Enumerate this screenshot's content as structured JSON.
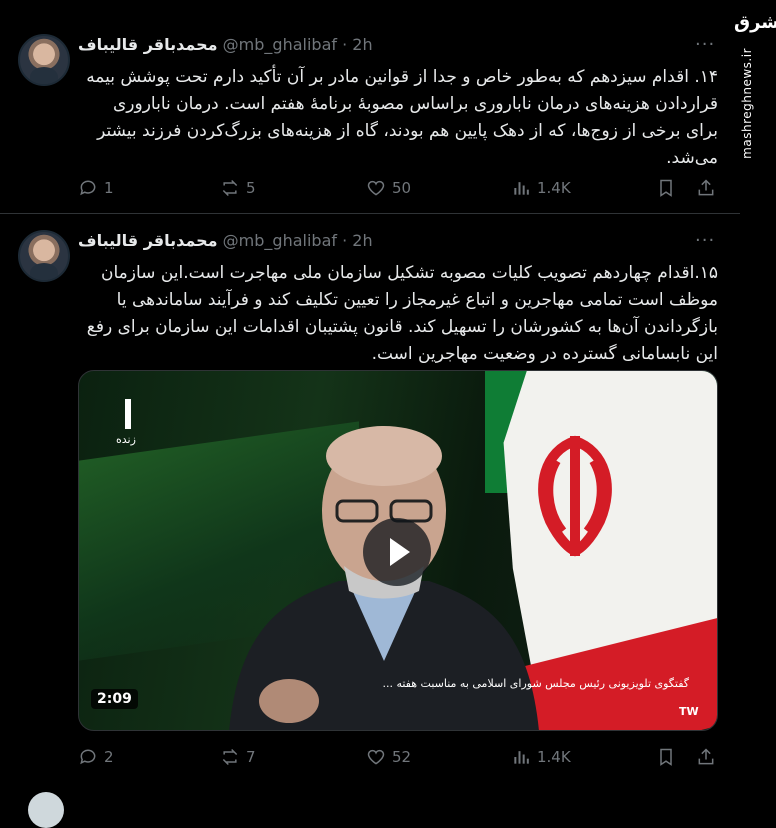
{
  "watermark": {
    "logo": "مشرق",
    "url": "mashreghnews.ir"
  },
  "tweets": [
    {
      "name": "محمدباقر قالیباف",
      "handle": "@mb_ghalibaf",
      "dot": "·",
      "time": "2h",
      "more": "···",
      "text": "۱۴. اقدام سیزدهم که به‌طور خاص و جدا از قوانین مادر بر آن تأکید دارم تحت پوشش بیمه قراردادن هزینه‌های درمان ناباروری براساس مصوبهٔ برنامهٔ هفتم است. درمان ناباروری برای برخی از زوج‌ها، که از دهک پایین هم بودند، گاه از هزینه‌های بزرگ‌کردن فرزند بیشتر می‌شد.",
      "stats": {
        "replies": "1",
        "reposts": "5",
        "likes": "50",
        "views": "1.4K"
      }
    },
    {
      "name": "محمدباقر قالیباف",
      "handle": "@mb_ghalibaf",
      "dot": "·",
      "time": "2h",
      "more": "···",
      "text": "۱۵.اقدام چهاردهم تصویب کلیات مصوبه تشکیل سازمان ملی مهاجرت است.این سازمان موظف است تمامی مهاجرین و اتباع غیرمجاز را تعیین تکلیف کند و فرآیند ساماندهی یا بازگرداندن آن‌ها به کشورشان را تسهیل کند. قانون پشتیبان اقدامات این سازمان برای رفع این نابسامانی گسترده در وضعیت مهاجرین است.",
      "video": {
        "live_label": "زنده",
        "caption": "گفتگوی تلویزیونی رئیس مجلس شورای اسلامی به مناسبت هفته ...",
        "duration": "2:09",
        "channel_badge": "TW"
      },
      "stats": {
        "replies": "2",
        "reposts": "7",
        "likes": "52",
        "views": "1.4K"
      }
    }
  ],
  "icons": [
    "reply-icon",
    "repost-icon",
    "like-icon",
    "views-icon",
    "bookmark-icon",
    "share-icon",
    "more-icon",
    "play-icon"
  ],
  "colors": {
    "background": "#000000",
    "text": "#e7e9ea",
    "muted": "#71767b",
    "border": "#2f3336"
  }
}
